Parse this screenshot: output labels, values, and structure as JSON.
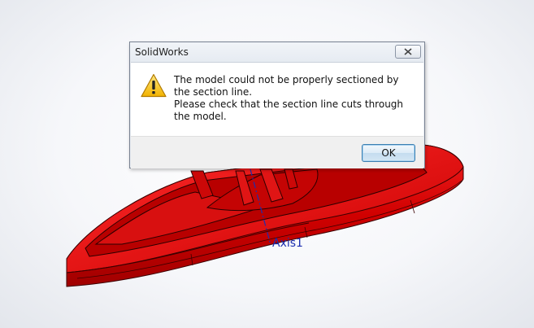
{
  "dialog": {
    "title": "SolidWorks",
    "message_line1": "The model could not be properly sectioned by the section line.",
    "message_line2": "Please check that the section line cuts through the model.",
    "ok_label": "OK",
    "icon": "warning-icon",
    "close_icon": "close-icon"
  },
  "viewport": {
    "axis_label": "Axis1",
    "model_color": "#d40000",
    "axis_color": "#1c2fb0"
  }
}
